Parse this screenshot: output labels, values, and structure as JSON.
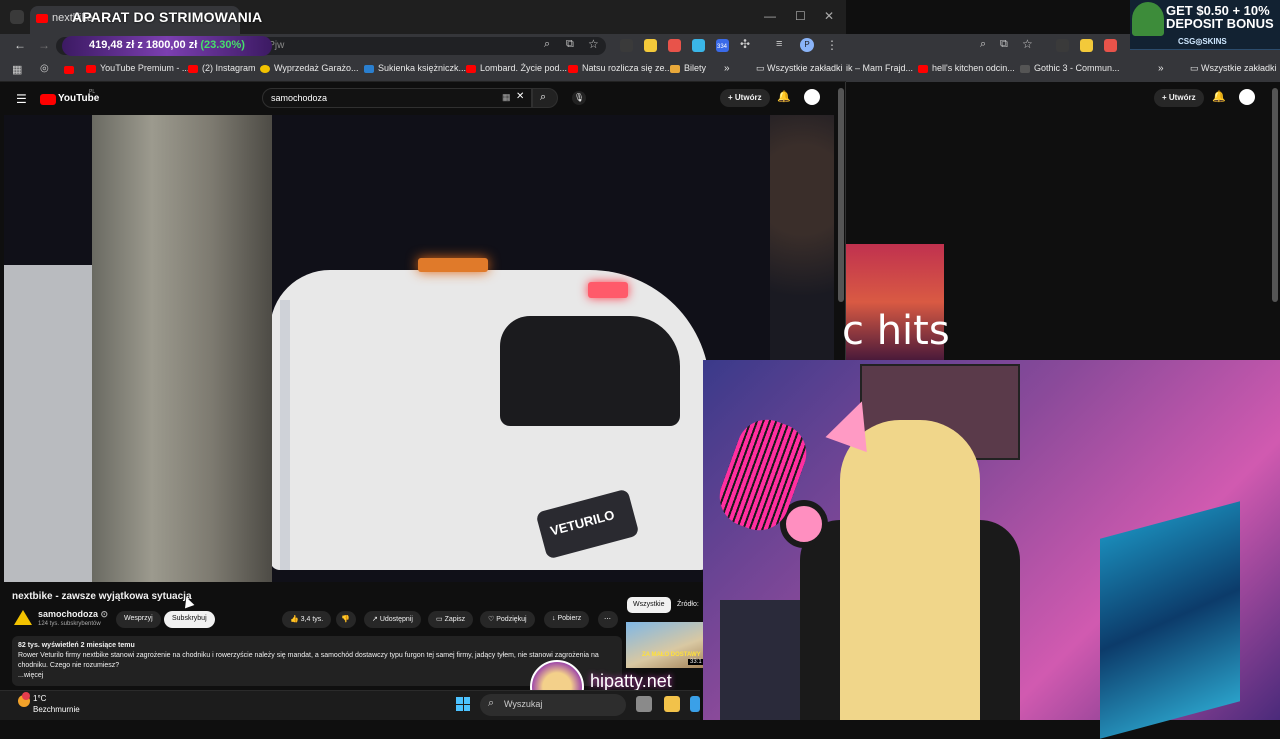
{
  "overlay": {
    "title": "APARAT DO STRIMOWANIA"
  },
  "promo": {
    "amount": "419,48 zł",
    "slash": "z",
    "target": "1800,00 zł",
    "percent": "(23.30%)"
  },
  "browser": {
    "tab_title": "nextbike",
    "url_suffix": "MJGZkPjw",
    "bookmarks": [
      "YouTube Premium - ...",
      "(2) Instagram",
      "Wyprzedaż Garażo...",
      "Sukienka księżniczk...",
      "Lombard. Życie pod...",
      "Natsu rozlicza się ze...",
      "Bilety"
    ],
    "all_bookmarks": "Wszystkie zakładki",
    "right_bookmarks": [
      "ik – Mam Frajd...",
      "hell's kitchen odcin...",
      "Gothic 3 - Commun..."
    ],
    "extension_badge": "334"
  },
  "youtube": {
    "logo_text": "YouTube",
    "logo_region": "PL",
    "search_value": "samochodoza",
    "create_label": "Utwórz",
    "video_title": "nextbike - zawsze wyjątkowa sytuacja",
    "channel": {
      "name": "samochodoza",
      "subs": "124 tys. subskrybentów"
    },
    "support_label": "Wesprzyj",
    "subscribe_label": "Subskrybuj",
    "likes": "3,4 tys.",
    "share_label": "Udostępnij",
    "save_label": "Zapisz",
    "thanks_label": "Podziękuj",
    "download_label": "Pobierz",
    "description": {
      "meta": "82 tys. wyświetleń  2 miesiące temu",
      "text": "Rower Veturilo firmy nextbike stanowi zagrożenie na chodniku i rowerzyście należy się mandat, a samochód dostawczy typu furgon tej samej firmy, jadący tyłem, nie stanowi zagrożenia na chodniku. Czego nie rozumiesz?",
      "more": "...więcej"
    },
    "filter_tabs": [
      "Wszystkie",
      "Źródło:"
    ],
    "thumb_caption": "ZA MAŁO DOSTAWY",
    "thumb_duration": "33:1",
    "van_logo": "VETURILO",
    "hits_text": "c hits"
  },
  "ad": {
    "title_line1": "GET $0.50 + 10%",
    "title_line2": "DEPOSIT BONUS",
    "brand": "CSG◎SKINS"
  },
  "watermark": {
    "text": "hipatty.net"
  },
  "taskbar": {
    "temp": "1°C",
    "weather": "Bezchmurnie",
    "search_placeholder": "Wyszukaj"
  },
  "colors": {
    "youtube_red": "#ff0000",
    "progress_green": "#46e06b",
    "accent_blue": "#4cc2ff"
  }
}
